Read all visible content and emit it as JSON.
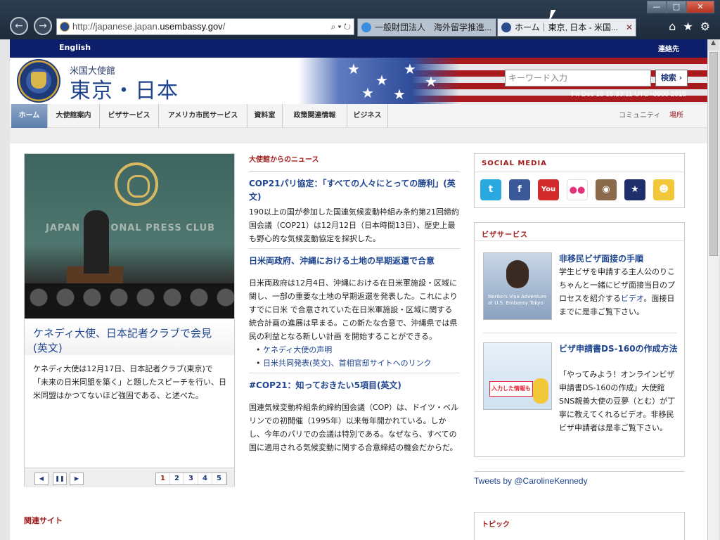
{
  "browser": {
    "address": {
      "prefix": "http://japanese.japan.",
      "domain": "usembassy.gov",
      "suffix": "/",
      "controls": "⌕ ▾ ↻"
    },
    "tabs": [
      {
        "label": "一般財団法人　海外留学推進..."
      },
      {
        "label": "ホーム｜東京, 日本 - 米国..."
      }
    ],
    "window_buttons": {
      "minimize": "—",
      "maximize": "□",
      "close": "✕"
    },
    "nav": {
      "back": "←",
      "forward": "→"
    },
    "tools": {
      "home": "⌂",
      "favorites": "★",
      "settings": "⚙"
    }
  },
  "header": {
    "lang": "English",
    "contact": "連絡先",
    "subtitle": "米国大使館",
    "title": "東京・日本",
    "search_placeholder": "キーワード入力",
    "search_button": "検索",
    "datetime": "Fri Dec 18 15:33:11 UTC+0900 2015"
  },
  "nav": {
    "items": [
      "ホーム",
      "大使館案内",
      "ビザサービス",
      "アメリカ市民サービス",
      "資料室",
      "政策関連情報",
      "ビジネス"
    ],
    "right": [
      "コミュニティ",
      "場所"
    ]
  },
  "feature": {
    "photo_sign": "JAPAN NATIONAL PRESS CLUB",
    "title": "ケネディ大使、日本記者クラブで会見(英文)",
    "desc": "ケネディ大使は12月17日、日本記者クラブ(東京)で「未来の日米同盟を築く」と題したスピーチを行い、日米同盟はかつてないほど強固である、と述べた。",
    "controls": {
      "prev": "◀",
      "pause": "❚❚",
      "next": "▶"
    },
    "pages": [
      "1",
      "2",
      "3",
      "4",
      "5"
    ]
  },
  "news": {
    "header": "大使館からのニュース",
    "items": [
      {
        "title": "COP21パリ協定：「すべての人々にとっての勝利」(英文)",
        "body": "190以上の国が参加した国連気候変動枠組み条約第21回締約国会議（COP21）は12月12日（日本時間13日）、歴史上最も野心的な気候変動協定を採択した。"
      },
      {
        "title": "日米両政府、沖縄における土地の早期返還で合意",
        "body": "日米両政府は12月4日、沖縄における在日米軍施設・区域に関し、一部の重要な土地の早期返還を発表した。これによりすでに日米 で合意されていた在日米軍施設・区域に関する統合計画の進展は早まる。この新たな合意で、沖縄県では県民の利益となる新しい計画 を開始することができる。"
      },
      {
        "title": "#COP21：知っておきたい5項目(英文)",
        "body": "国連気候変動枠組条約締約国会議（COP）は、ドイツ・ベルリンでの初開催（1995年）以来毎年開かれている。しかし、今年のパリでの会議は特別である。なぜなら、すべての国に適用される気候変動に関する合意締結の機会だからだ。"
      }
    ],
    "links": [
      "ケネディ大使の声明",
      "日米共同発表(英文)、首相官邸サイトへのリンク"
    ]
  },
  "social": {
    "header": "SOCIAL MEDIA",
    "icons": [
      {
        "name": "twitter-icon",
        "glyph": "t",
        "color": "#2aa8e0"
      },
      {
        "name": "facebook-icon",
        "glyph": "f",
        "color": "#3b5998"
      },
      {
        "name": "youtube-icon",
        "glyph": "You",
        "color": "#d32b2b"
      },
      {
        "name": "flickr-icon",
        "glyph": "●●",
        "color": "#ffffff"
      },
      {
        "name": "instagram-icon",
        "glyph": "◉",
        "color": "#8a6a4a"
      },
      {
        "name": "americanview-icon",
        "glyph": "★",
        "color": "#1f2f6b"
      },
      {
        "name": "mascot-icon",
        "glyph": "☻",
        "color": "#f2c838"
      }
    ]
  },
  "visa": {
    "header": "ビザサービス",
    "items": [
      {
        "title": "非移民ビザ面接の手順",
        "desc_pre": "学生ビザを申請する主人公のりこちゃんと一緒にビザ面接当日のプロセスを紹介する",
        "link": "ビデオ",
        "desc_post": "。面接日までに是非ご覧下さい。",
        "img_caption": "Noriko's Visa Adventure at U.S. Embassy Tokyo"
      },
      {
        "title": "ビザ申請書DS-160の作成方法",
        "desc": "「やってみよう！オンラインビザ申請書DS-160の作成」大使館SNS親善大使の豆夢（とむ）が丁寧に教えてくれるビデオ。非移民ビザ申請者は是非ご覧下さい。",
        "img_caption": "入力した情報もSAVE!"
      }
    ]
  },
  "tweets": "Tweets by @CarolineKennedy",
  "related": "関連サイト",
  "topic": "トピック"
}
